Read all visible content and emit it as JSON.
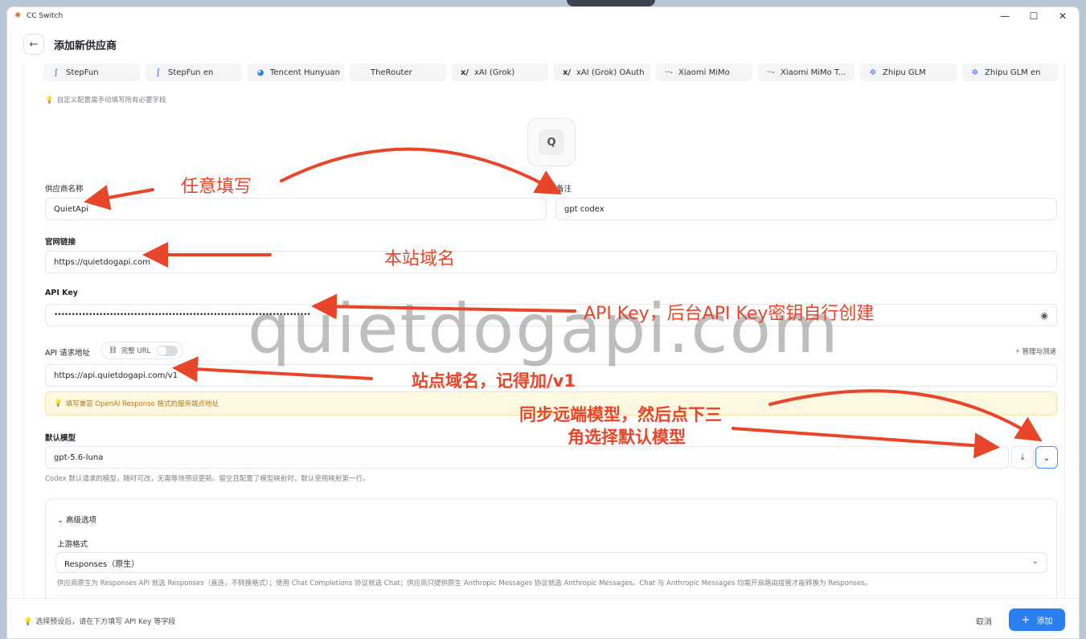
{
  "window": {
    "title": "CC Switch"
  },
  "header": {
    "title": "添加新供应商"
  },
  "presets": [
    {
      "icon": "stepfun",
      "label": "StepFun"
    },
    {
      "icon": "stepfun",
      "label": "StepFun en"
    },
    {
      "icon": "hunyuan",
      "label": "Tencent Hunyuan"
    },
    {
      "icon": "",
      "label": "TheRouter"
    },
    {
      "icon": "xai",
      "label": "xAI (Grok)"
    },
    {
      "icon": "xai",
      "label": "xAI (Grok) OAuth"
    },
    {
      "icon": "mimo",
      "label": "Xiaomi MiMo"
    },
    {
      "icon": "mimo",
      "label": "Xiaomi MiMo T..."
    },
    {
      "icon": "zhipu",
      "label": "Zhipu GLM"
    },
    {
      "icon": "zhipu",
      "label": "Zhipu GLM en"
    }
  ],
  "hint_custom": "自定义配置需手动填写所有必要字段",
  "logo": {
    "letter": "Q"
  },
  "form": {
    "name_label": "供应商名称",
    "name_value": "QuietApi",
    "note_label": "备注",
    "note_value": "gpt codex",
    "website_label": "官网链接",
    "website_value": "https://quietdogapi.com",
    "apikey_label": "API Key",
    "apikey_value": "••••••••••••••••••••••••••••••••••••••••••••••••••••••••••••••••••••••••••",
    "endpoint_label": "API 请求地址",
    "full_url_label": "完整 URL",
    "manage_label": "管理与测速",
    "endpoint_value": "https://api.quietdogapi.com/v1",
    "endpoint_warning": "填写兼容 OpenAI Response 格式的服务端点地址",
    "model_label": "默认模型",
    "model_value": "gpt-5.6-luna",
    "model_help": "Codex 默认请求的模型，随时可改，无需等待预设更新。留空且配置了模型映射时，默认使用映射第一行。"
  },
  "advanced": {
    "title": "高级选项",
    "upstream_label": "上游格式",
    "upstream_value": "Responses（原生）",
    "upstream_help": "供应商原生为 Responses API 就选 Responses（直连，不转换格式）；使用 Chat Completions 协议就选 Chat；供应商只提供原生 Anthropic Messages 协议就选 Anthropic Messages。Chat 与 Anthropic Messages 均需开启路由接管才能转换为 Responses。"
  },
  "footer": {
    "hint": "选择预设后，请在下方填写 API Key 等字段",
    "cancel": "取消",
    "add": "添加"
  },
  "annotations": {
    "any_fill": "任意填写",
    "site_domain": "本站域名",
    "apikey_note": "API Key，后台API Key密钥自行创建",
    "endpoint_note": "站点域名，记得加/v1",
    "model_note_line1": "同步远端模型，然后点下三",
    "model_note_line2": "角选择默认模型",
    "watermark": "quietdogapi.com"
  },
  "colors": {
    "accent": "#2c7ff0",
    "annotation": "#e8462a",
    "warning_bg": "#fff8e1"
  }
}
